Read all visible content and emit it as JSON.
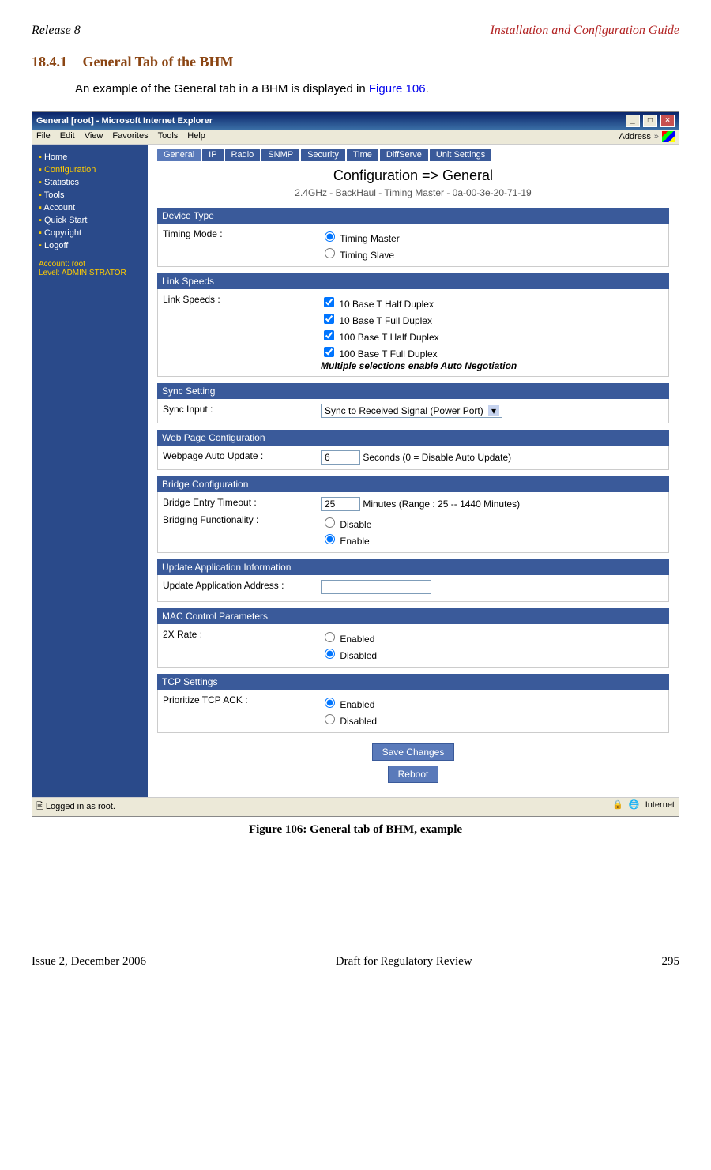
{
  "header": {
    "left": "Release 8",
    "right": "Installation and Configuration Guide"
  },
  "section": {
    "number": "18.4.1",
    "title": "General Tab of the BHM"
  },
  "body": {
    "text1": "An example of the General tab in a BHM is displayed in ",
    "figlink": "Figure 106",
    "text2": "."
  },
  "figure": {
    "caption": "Figure 106: General tab of BHM, example"
  },
  "browser": {
    "title": "General [root] - Microsoft Internet Explorer",
    "menu": [
      "File",
      "Edit",
      "View",
      "Favorites",
      "Tools",
      "Help"
    ],
    "address_label": "Address",
    "sidebar": {
      "items": [
        "Home",
        "Configuration",
        "Statistics",
        "Tools",
        "Account",
        "Quick Start",
        "Copyright",
        "Logoff"
      ],
      "account1": "Account: root",
      "account2": "Level: ADMINISTRATOR"
    },
    "tabs": [
      "General",
      "IP",
      "Radio",
      "SNMP",
      "Security",
      "Time",
      "DiffServe",
      "Unit Settings"
    ],
    "page_title": "Configuration => General",
    "page_subtitle": "2.4GHz - BackHaul - Timing Master - 0a-00-3e-20-71-19",
    "device_type": {
      "header": "Device Type",
      "label": "Timing Mode :",
      "opt1": "Timing Master",
      "opt2": "Timing Slave"
    },
    "link_speeds": {
      "header": "Link Speeds",
      "label": "Link Speeds :",
      "opts": [
        "10 Base T Half Duplex",
        "10 Base T Full Duplex",
        "100 Base T Half Duplex",
        "100 Base T Full Duplex"
      ],
      "note": "Multiple selections enable Auto Negotiation"
    },
    "sync": {
      "header": "Sync Setting",
      "label": "Sync Input :",
      "value": "Sync to Received Signal (Power Port)"
    },
    "webpage": {
      "header": "Web Page Configuration",
      "label": "Webpage Auto Update :",
      "value": "6",
      "suffix": "Seconds (0 = Disable Auto Update)"
    },
    "bridge": {
      "header": "Bridge Configuration",
      "label1": "Bridge Entry Timeout :",
      "value1": "25",
      "suffix1": "Minutes (Range : 25 -- 1440 Minutes)",
      "label2": "Bridging Functionality :",
      "opt1": "Disable",
      "opt2": "Enable"
    },
    "update": {
      "header": "Update Application Information",
      "label": "Update Application Address :"
    },
    "mac": {
      "header": "MAC Control Parameters",
      "label": "2X Rate :",
      "opt1": "Enabled",
      "opt2": "Disabled"
    },
    "tcp": {
      "header": "TCP Settings",
      "label": "Prioritize TCP ACK :",
      "opt1": "Enabled",
      "opt2": "Disabled"
    },
    "buttons": {
      "save": "Save Changes",
      "reboot": "Reboot"
    },
    "statusbar": {
      "left": "Logged in as root.",
      "right": "Internet"
    }
  },
  "footer": {
    "left": "Issue 2, December 2006",
    "center": "Draft for Regulatory Review",
    "right": "295"
  }
}
